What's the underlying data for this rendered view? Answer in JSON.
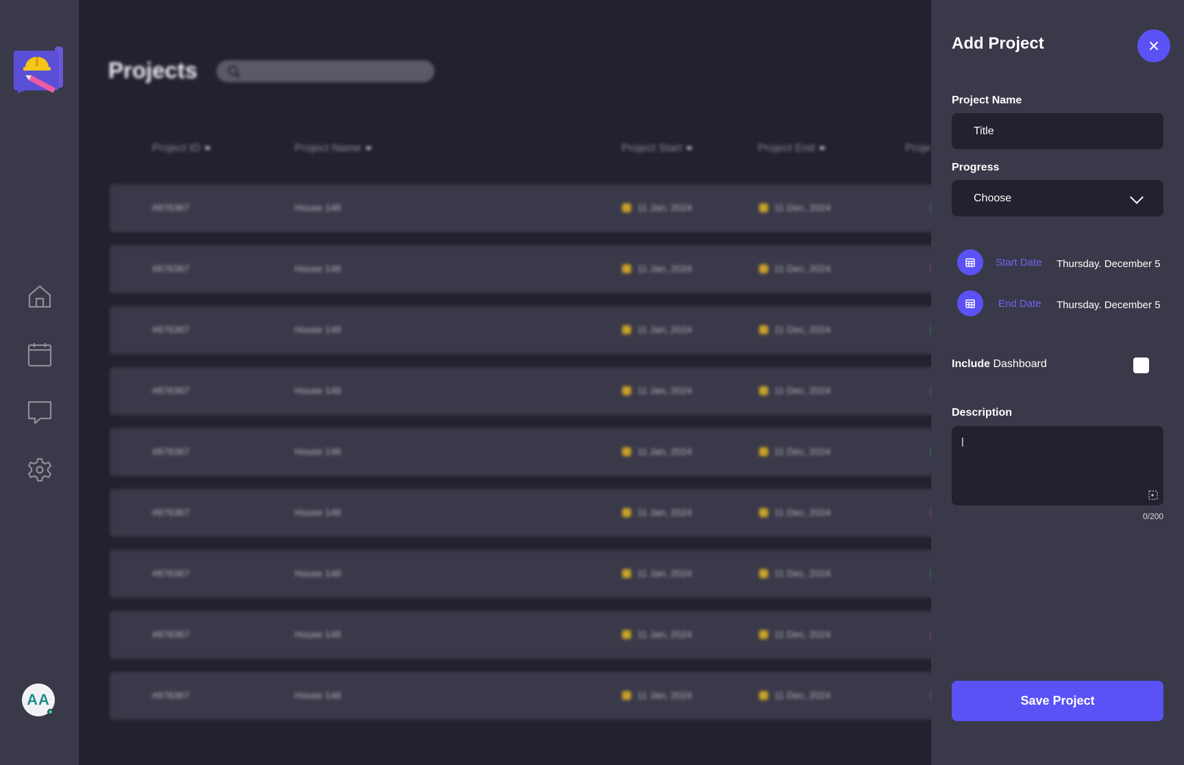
{
  "main": {
    "title": "Projects",
    "columns": [
      "Project ID",
      "Project Name",
      "Project Start",
      "Project End",
      "Proje"
    ],
    "rows": [
      {
        "id": "#876367",
        "name": "House 148",
        "start": "11 Jan, 2024",
        "end": "11 Dec, 2024",
        "status_color": "#32d39c"
      },
      {
        "id": "#876367",
        "name": "House 148",
        "start": "11 Jan, 2024",
        "end": "11 Dec, 2024",
        "status_color": "#f763a9"
      },
      {
        "id": "#876367",
        "name": "House 148",
        "start": "11 Jan, 2024",
        "end": "11 Dec, 2024",
        "status_color": "#32d39c"
      },
      {
        "id": "#876367",
        "name": "House 148",
        "start": "11 Jan, 2024",
        "end": "11 Dec, 2024",
        "status_color": "#f763a9"
      },
      {
        "id": "#876367",
        "name": "House 148",
        "start": "11 Jan, 2024",
        "end": "11 Dec, 2024",
        "status_color": "#32d39c"
      },
      {
        "id": "#876367",
        "name": "House 148",
        "start": "11 Jan, 2024",
        "end": "11 Dec, 2024",
        "status_color": "#f763a9"
      },
      {
        "id": "#876367",
        "name": "House 148",
        "start": "11 Jan, 2024",
        "end": "11 Dec, 2024",
        "status_color": "#32d39c"
      },
      {
        "id": "#876367",
        "name": "House 148",
        "start": "11 Jan, 2024",
        "end": "11 Dec, 2024",
        "status_color": "#f763a9"
      },
      {
        "id": "#876367",
        "name": "House 148",
        "start": "11 Jan, 2024",
        "end": "11 Dec, 2024",
        "status_color": "#f763a9"
      }
    ]
  },
  "sidebar": {
    "icons": [
      "home-icon",
      "calendar-icon",
      "chat-icon",
      "settings-icon"
    ],
    "avatar_initials": "AA"
  },
  "panel": {
    "title": "Add Project",
    "close_icon": "close-icon",
    "project_name_label": "Project Name",
    "project_name_value": "Title",
    "progress_label": "Progress",
    "progress_value": "Choose",
    "start_date_label": "Start Date",
    "start_date_value": "Thursday. December 5",
    "end_date_label": "End Date",
    "end_date_value": "Thursday. December 5",
    "include_bold": "Include",
    "include_rest": "Dashboard",
    "description_label": "Description",
    "description_value": "|",
    "counter": "0/200",
    "save_label": "Save Project"
  },
  "colors": {
    "accent": "#5a52f5",
    "green": "#32d39c",
    "pink": "#f763a9",
    "background": "#22212f",
    "surface": "#3a3949"
  }
}
